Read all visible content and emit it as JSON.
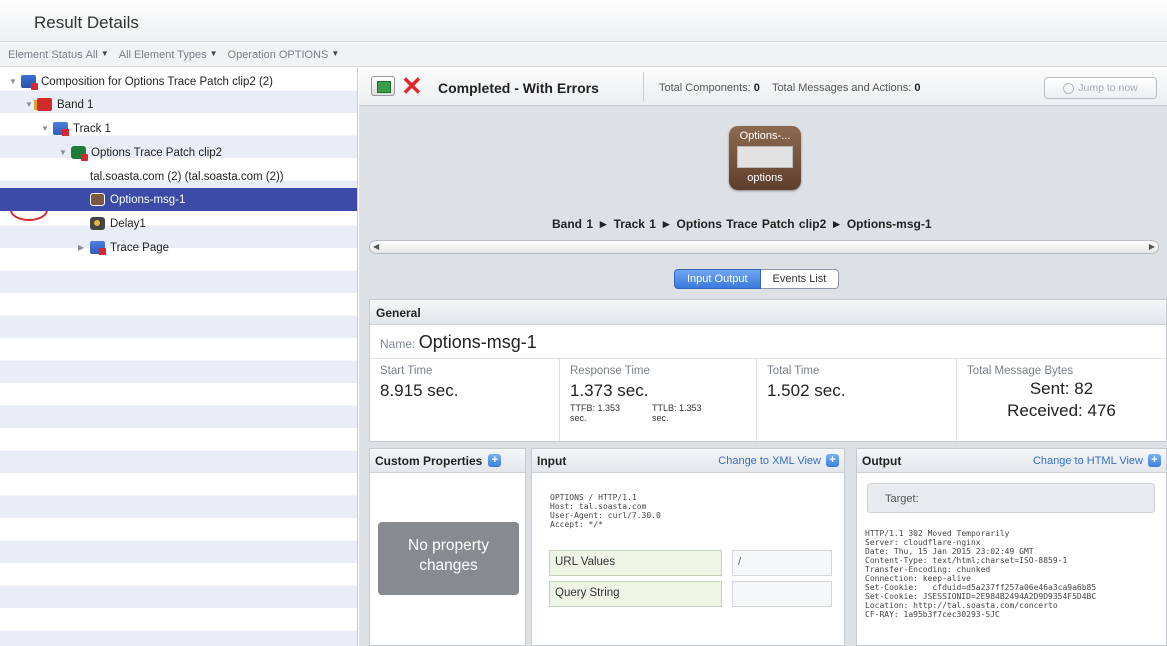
{
  "header": {
    "title": "Result Details"
  },
  "filters": {
    "element_status_label": "Element Status",
    "element_status_value": "All",
    "element_types_value": "All Element Types",
    "operation_label": "Operation",
    "operation_value": "OPTIONS"
  },
  "tree": {
    "items": [
      {
        "label": "Composition for Options Trace Patch clip2 (2)"
      },
      {
        "label": "Band 1"
      },
      {
        "label": "Track 1"
      },
      {
        "label": "Options Trace Patch clip2"
      },
      {
        "label": "tal.soasta.com (2) (tal.soasta.com (2))"
      },
      {
        "label": "Options-msg-1"
      },
      {
        "label": "Delay1"
      },
      {
        "label": "Trace Page"
      }
    ]
  },
  "status": {
    "text": "Completed - With Errors",
    "total_components_label": "Total Components:",
    "total_components_value": "0",
    "total_messages_label": "Total Messages and Actions:",
    "total_messages_value": "0",
    "jump_label": "Jump to now"
  },
  "message_icon": {
    "title": "Options-...",
    "caption": "options"
  },
  "breadcrumb": {
    "items": [
      "Band 1",
      "Track 1",
      "Options Trace Patch clip2",
      "Options-msg-1"
    ],
    "separator": "►"
  },
  "tabs": [
    "Input Output",
    "Events List"
  ],
  "general": {
    "header": "General",
    "name_label": "Name:",
    "name_value": "Options-msg-1",
    "start_time_label": "Start Time",
    "start_time_value": "8.915 sec.",
    "response_time_label": "Response Time",
    "response_time_value": "1.373 sec.",
    "ttfb": "TTFB: 1.353 sec.",
    "ttlb": "TTLB: 1.353 sec.",
    "total_time_label": "Total Time",
    "total_time_value": "1.502 sec.",
    "bytes_label": "Total Message Bytes",
    "sent": "Sent: 82",
    "received": "Received: 476"
  },
  "custom_properties": {
    "header": "Custom Properties",
    "empty": "No property changes"
  },
  "input": {
    "header": "Input",
    "link": "Change to XML View",
    "request": "OPTIONS / HTTP/1.1\nHost: tal.soasta.com\nUser-Agent: curl/7.30.0\nAccept: */*",
    "url_values_label": "URL Values",
    "url_values_value": "/",
    "query_string_label": "Query String",
    "query_string_value": ""
  },
  "output": {
    "header": "Output",
    "link": "Change to HTML View",
    "target_label": "Target:",
    "response": "HTTP/1.1 302 Moved Temporarily\nServer: cloudflare-nginx\nDate: Thu, 15 Jan 2015 23:02:49 GMT\nContent-Type: text/html;charset=ISO-8859-1\nTransfer-Encoding: chunked\nConnection: keep-alive\nSet-Cookie:   cfduid=d5a237ff257a06e46a3ca9a6b85\nSet-Cookie: JSESSIONID=2E984B2494A2D9D9354F5D4BC\nLocation: http://tal.soasta.com/concerto\nCF-RAY: 1a95b3f7cec30293-SJC"
  },
  "colors": {
    "selection": "#3b4ba7",
    "error_red": "#e2262c",
    "active_tab": "#3b79dc",
    "link": "#3470c8"
  }
}
